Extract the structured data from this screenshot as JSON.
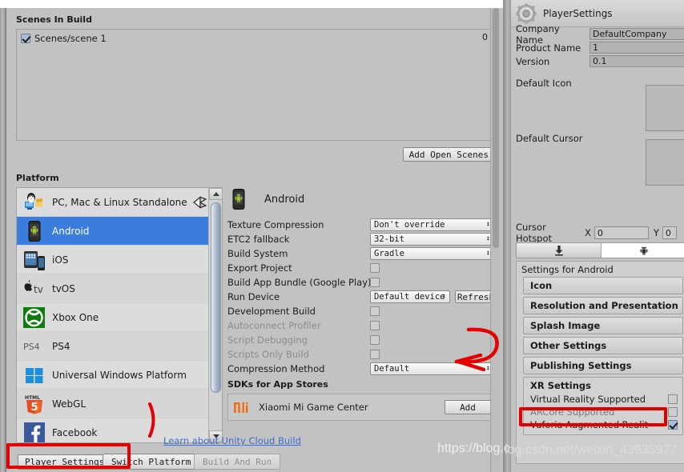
{
  "build_window": {
    "scenes_section_title": "Scenes In Build",
    "scenes": [
      {
        "name": "Scenes/scene 1",
        "checked": true,
        "index": "0"
      }
    ],
    "add_open_scenes_label": "Add Open Scenes",
    "platform_section_title": "Platform",
    "platforms": [
      {
        "label": "PC, Mac & Linux Standalone",
        "icon": "windows-linux-icon",
        "selected": false
      },
      {
        "label": "Android",
        "icon": "android-phone-icon",
        "selected": true
      },
      {
        "label": "iOS",
        "icon": "ios-device-icon",
        "selected": false
      },
      {
        "label": "tvOS",
        "icon": "appletv-icon",
        "selected": false
      },
      {
        "label": "Xbox One",
        "icon": "xbox-icon",
        "selected": false
      },
      {
        "label": "PS4",
        "icon": "ps4-icon",
        "selected": false
      },
      {
        "label": "Universal Windows Platform",
        "icon": "windows-icon",
        "selected": false
      },
      {
        "label": "WebGL",
        "icon": "html5-icon",
        "selected": false
      },
      {
        "label": "Facebook",
        "icon": "facebook-icon",
        "selected": false
      }
    ],
    "player_settings_label": "Player Settings...",
    "android_panel": {
      "heading": "Android",
      "properties": [
        {
          "name": "Texture Compression",
          "type": "popup",
          "value": "Don't override",
          "dim": false
        },
        {
          "name": "ETC2 fallback",
          "type": "popup",
          "value": "32-bit",
          "dim": false
        },
        {
          "name": "Build System",
          "type": "popup",
          "value": "Gradle",
          "dim": false
        },
        {
          "name": "Export Project",
          "type": "checkbox",
          "checked": false,
          "dim": false
        },
        {
          "name": "Build App Bundle (Google Play)",
          "type": "checkbox",
          "checked": false,
          "dim": false
        },
        {
          "name": "Run Device",
          "type": "popup-button",
          "value": "Default device",
          "button": "Refresh",
          "dim": false
        },
        {
          "name": "Development Build",
          "type": "checkbox",
          "checked": false,
          "dim": false
        },
        {
          "name": "Autoconnect Profiler",
          "type": "checkbox",
          "checked": false,
          "dim": true
        },
        {
          "name": "Script Debugging",
          "type": "checkbox",
          "checked": false,
          "dim": true
        },
        {
          "name": "Scripts Only Build",
          "type": "checkbox",
          "checked": false,
          "dim": true
        },
        {
          "name": "Compression Method",
          "type": "popup",
          "value": "Default",
          "dim": false
        }
      ],
      "sdk_section_title": "SDKs for App Stores",
      "sdk_name": "Xiaomi Mi Game Center",
      "sdk_add_label": "Add"
    },
    "cloud_build_link": "Learn about Unity Cloud Build",
    "switch_platform_label": "Switch Platform",
    "build_and_run_label": "Build And Run"
  },
  "inspector": {
    "title": "PlayerSettings",
    "fields": [
      {
        "label": "Company Name",
        "value": "DefaultCompany"
      },
      {
        "label": "Product Name",
        "value": "1"
      },
      {
        "label": "Version",
        "value": "0.1"
      }
    ],
    "default_icon_label": "Default Icon",
    "default_cursor_label": "Default Cursor",
    "cursor_hotspot_label": "Cursor Hotspot",
    "hotspot_x_label": "X",
    "hotspot_x_value": "0",
    "hotspot_y_label": "Y",
    "hotspot_y_value": "0",
    "platform_tabs": [
      {
        "icon": "download-standalone-icon",
        "active": false
      },
      {
        "icon": "android-icon",
        "active": true
      }
    ],
    "settings_for_label": "Settings for Android",
    "foldouts": [
      "Icon",
      "Resolution and Presentation",
      "Splash Image",
      "Other Settings",
      "Publishing Settings"
    ],
    "xr": {
      "title": "XR Settings",
      "rows": [
        {
          "label": "Virtual Reality Supported",
          "checked": false,
          "dim": false
        },
        {
          "label": "ARCore Supported",
          "checked": false,
          "dim": true
        },
        {
          "label": "Vuforia Augmented Realit",
          "checked": true,
          "dim": false
        }
      ]
    }
  },
  "annotations": {
    "color": "#e50000",
    "marks": [
      "rect-player-settings",
      "rect-vuforia",
      "curve-arrow-compression",
      "stroke-left"
    ]
  },
  "watermark": {
    "left_text": "https://blog.c",
    "right_text": "log.csdn.net/weixin_43935977"
  }
}
